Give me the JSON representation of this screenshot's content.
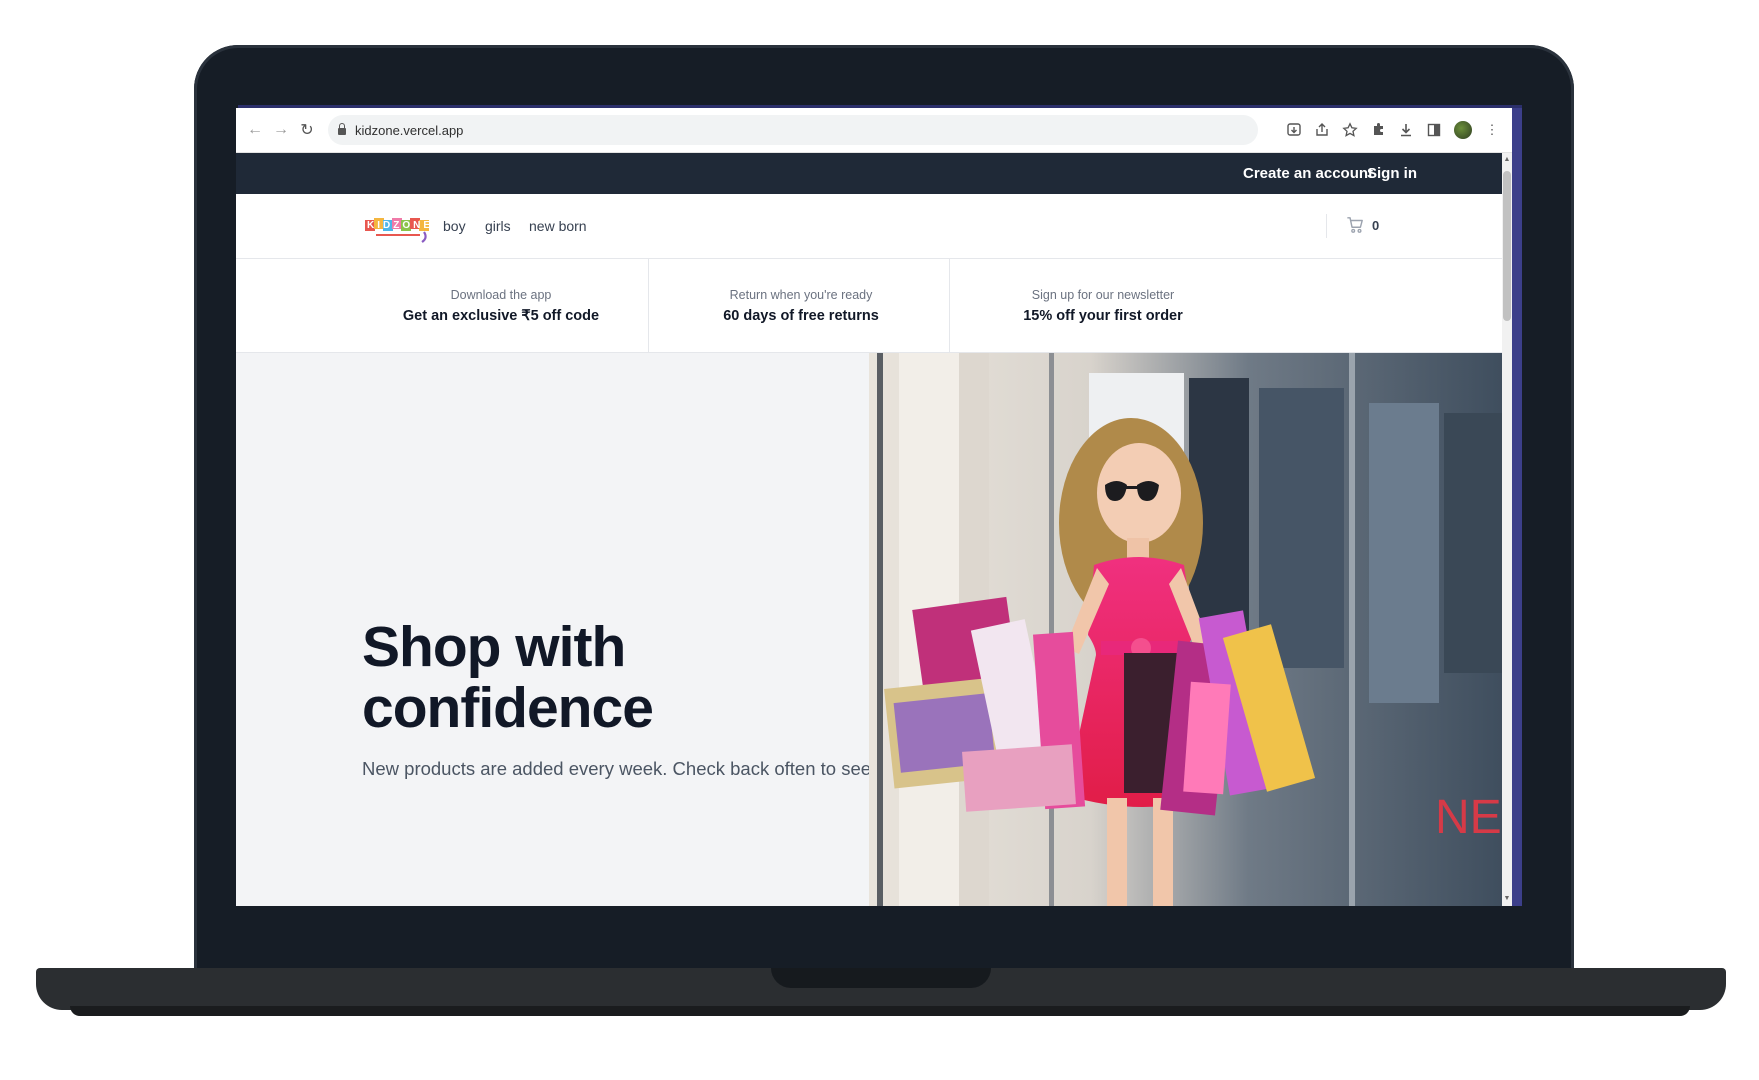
{
  "browser": {
    "url": "kidzone.vercel.app",
    "icons": [
      "back-arrow-icon",
      "forward-arrow-icon",
      "reload-icon",
      "lock-icon",
      "install-icon",
      "share-icon",
      "star-icon",
      "extensions-icon",
      "download-icon",
      "side-panel-icon",
      "profile-avatar",
      "kebab-menu-icon"
    ]
  },
  "topbar": {
    "create_account": "Create an account",
    "sign_in": "Sign in"
  },
  "navbar": {
    "logo_text": "KIDZONE",
    "links": [
      "boy",
      "girls",
      "new born"
    ],
    "cart_count": "0"
  },
  "perks": [
    {
      "small": "Download the app",
      "big": "Get an exclusive ₹5 off code"
    },
    {
      "small": "Return when you're ready",
      "big": "60 days of free returns"
    },
    {
      "small": "Sign up for our newsletter",
      "big": "15% off your first order"
    }
  ],
  "hero": {
    "title_line1": "Shop with",
    "title_line2": "confidence",
    "subtitle": "New products are added every week. Check back often to see",
    "store_sign": "NEW COL"
  },
  "colors": {
    "topbar": "#1f2937",
    "hero_bg": "#f3f4f6",
    "dress_pink": "#e8287a",
    "laptop": "#161d26"
  }
}
